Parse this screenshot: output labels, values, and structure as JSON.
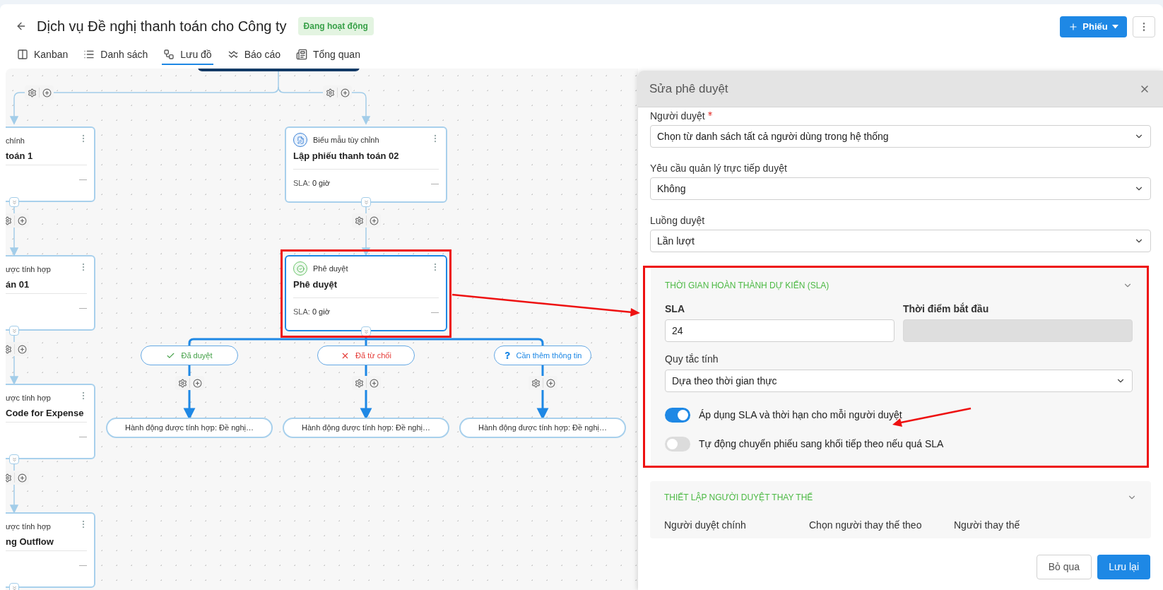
{
  "header": {
    "title": "Dịch vụ Đề nghị thanh toán cho Công ty",
    "status": "Đang hoạt động",
    "new_button": "Phiếu"
  },
  "tabs": [
    {
      "kind": "kanban",
      "label": "Kanban",
      "selected": false
    },
    {
      "kind": "list",
      "label": "Danh sách",
      "selected": false
    },
    {
      "kind": "flow",
      "label": "Lưu đồ",
      "selected": true
    },
    {
      "kind": "report",
      "label": "Báo cáo",
      "selected": false
    },
    {
      "kind": "overview",
      "label": "Tổng quan",
      "selected": false
    }
  ],
  "canvas": {
    "side_cards": [
      {
        "type_label": "chính",
        "title": "toán 1",
        "footer": "—"
      },
      {
        "type_label": "ược tính hợp",
        "title": "án 01",
        "footer": "—"
      },
      {
        "type_label": "ược tính hợp",
        "title": "Code for Expense",
        "footer": "—"
      },
      {
        "type_label": "ược tính hợp",
        "title": "ng Outflow",
        "footer": "—"
      }
    ],
    "flow_cards": [
      {
        "kind": "form",
        "type_label": "Biểu mẫu tùy chỉnh",
        "title": "Lập phiếu thanh toán 02",
        "sla_label": "SLA:",
        "sla_value": "0 giờ",
        "footer": "—",
        "selected": false
      },
      {
        "kind": "approval",
        "type_label": "Phê duyệt",
        "title": "Phê duyệt",
        "sla_label": "SLA:",
        "sla_value": "0 giờ",
        "footer": "—",
        "selected": true
      }
    ],
    "branches": [
      {
        "kind": "approved",
        "label": "Đã duyệt",
        "action": "Hành động được tính hợp: Đề nghị…"
      },
      {
        "kind": "rejected",
        "label": "Đã từ chối",
        "action": "Hành động được tính hợp: Đề nghị…"
      },
      {
        "kind": "more_info",
        "label": "Cần thêm thông tin",
        "action": "Hành động được tính hợp: Đề nghị…"
      }
    ]
  },
  "panel": {
    "title": "Sửa phê duyệt",
    "fields": [
      {
        "label": "Người duyệt",
        "required": true,
        "value": "Chọn từ danh sách tất cả người dùng trong hệ thống"
      },
      {
        "label": "Yêu cầu quản lý trực tiếp duyệt",
        "required": false,
        "value": "Không"
      },
      {
        "label": "Luồng duyệt",
        "required": false,
        "value": "Lần lượt"
      }
    ],
    "sla_section": {
      "title": "THỜI GIAN HOÀN THÀNH DỰ KIẾN (SLA)",
      "sla_label": "SLA",
      "sla_value": "24",
      "start_label": "Thời điểm bắt đầu",
      "rule_label": "Quy tắc tính",
      "rule_value": "Dựa theo thời gian thực",
      "toggles": [
        {
          "label": "Áp dụng SLA và thời hạn cho mỗi người duyệt",
          "on": true
        },
        {
          "label": "Tự động chuyển phiếu sang khối tiếp theo nếu quá SLA",
          "on": false
        }
      ]
    },
    "substitute_section": {
      "title": "THIẾT LẬP NGƯỜI DUYỆT THAY THẾ",
      "columns": [
        "Người duyệt chính",
        "Chọn người thay thế theo",
        "Người thay thế"
      ]
    },
    "cancel_button": "Bỏ qua",
    "save_button": "Lưu lại"
  }
}
